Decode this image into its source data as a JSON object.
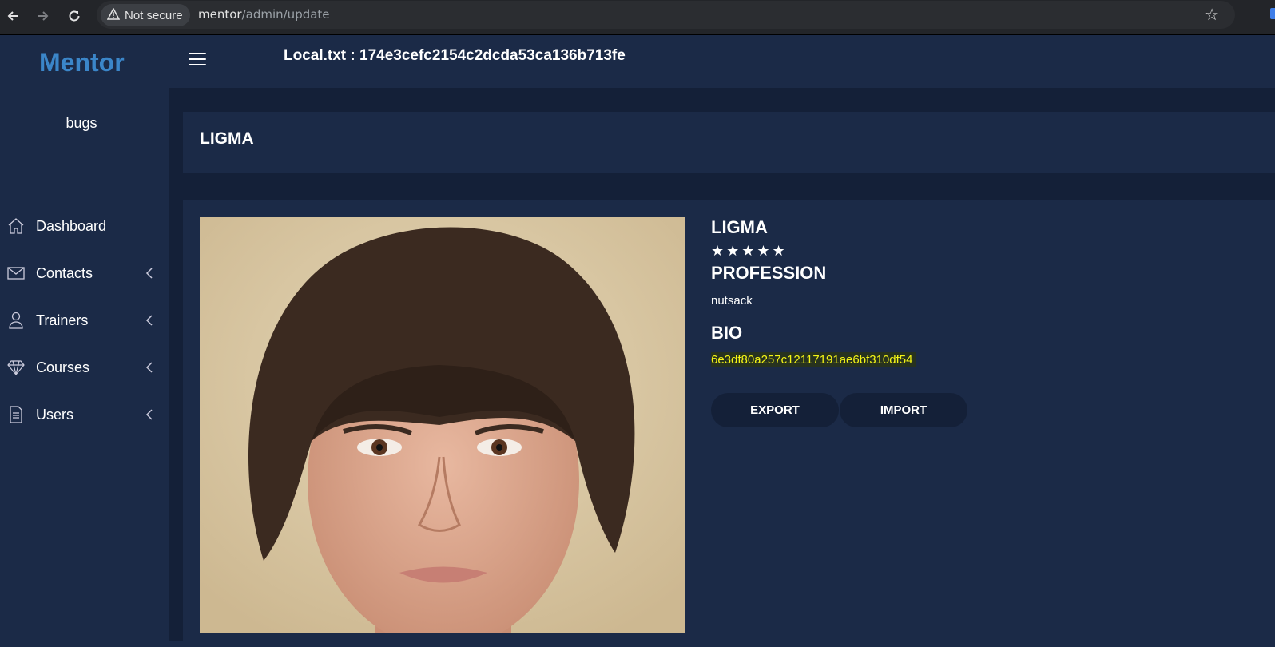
{
  "browser": {
    "security_label": "Not secure",
    "url_host": "mentor",
    "url_path": "/admin/update"
  },
  "sidebar": {
    "logo": "Mentor",
    "username": "bugs",
    "items": [
      {
        "label": "Dashboard",
        "icon": "home-icon",
        "has_submenu": false
      },
      {
        "label": "Contacts",
        "icon": "envelope-icon",
        "has_submenu": true
      },
      {
        "label": "Trainers",
        "icon": "person-icon",
        "has_submenu": true
      },
      {
        "label": "Courses",
        "icon": "diamond-icon",
        "has_submenu": true
      },
      {
        "label": "Users",
        "icon": "document-icon",
        "has_submenu": true
      }
    ]
  },
  "header": {
    "local_text": "Local.txt : 174e3cefc2154c2dcda53ca136b713fe"
  },
  "page": {
    "title": "LIGMA"
  },
  "profile": {
    "name": "LIGMA",
    "rating": 5,
    "stars": "★★★★★",
    "profession_heading": "PROFESSION",
    "profession": "nutsack",
    "bio_heading": "BIO",
    "bio": "6e3df80a257c12117191ae6bf310df54",
    "export_label": "EXPORT",
    "import_label": "IMPORT"
  },
  "colors": {
    "background": "#1b2a47",
    "content_bg": "#142038",
    "logo": "#3b86c9",
    "bio_highlight": "#f5f516"
  }
}
